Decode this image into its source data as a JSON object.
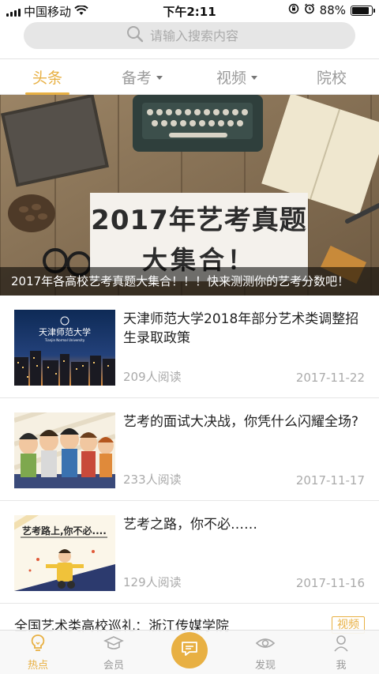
{
  "status_bar": {
    "carrier": "中国移动",
    "time": "下午2:11",
    "battery_text": "88%",
    "battery_level": 0.88
  },
  "search": {
    "placeholder": "请输入搜索内容"
  },
  "tabs": [
    {
      "label": "头条",
      "active": true,
      "dropdown": false
    },
    {
      "label": "备考",
      "active": false,
      "dropdown": true
    },
    {
      "label": "视频",
      "active": false,
      "dropdown": true
    },
    {
      "label": "院校",
      "active": false,
      "dropdown": false
    }
  ],
  "banner": {
    "image_title_line1": "2017年艺考真题",
    "image_title_line2": "大集合！",
    "caption": "2017年各高校艺考真题大集合！！！快来测测你的艺考分数吧！"
  },
  "news": [
    {
      "title": "天津师范大学2018年部分艺术类调整招生录取政策",
      "reads": "209人阅读",
      "date": "2017-11-22",
      "thumb_text": "天津师范大学",
      "thumb_subtext": "Tianjin Normal University"
    },
    {
      "title": "艺考的面试大决战，你凭什么闪耀全场?",
      "reads": "233人阅读",
      "date": "2017-11-17"
    },
    {
      "title": "艺考之路，你不必……",
      "reads": "129人阅读",
      "date": "2017-11-16",
      "thumb_text": "艺考路上,你不必...."
    }
  ],
  "partial_news": {
    "title": "全国艺术类高校巡礼：浙江传媒学院",
    "tag": "视频"
  },
  "bottom_nav": [
    {
      "label": "热点",
      "icon": "lightbulb-icon",
      "active": true
    },
    {
      "label": "会员",
      "icon": "graduation-cap-icon",
      "active": false
    },
    {
      "label": "",
      "icon": "chat-bubble-icon",
      "active": false
    },
    {
      "label": "发现",
      "icon": "eye-icon",
      "active": false
    },
    {
      "label": "我",
      "icon": "person-icon",
      "active": false
    }
  ],
  "colors": {
    "accent": "#e8b043",
    "inactive": "#9a9a9a",
    "meta_text": "#aaaaaa"
  }
}
